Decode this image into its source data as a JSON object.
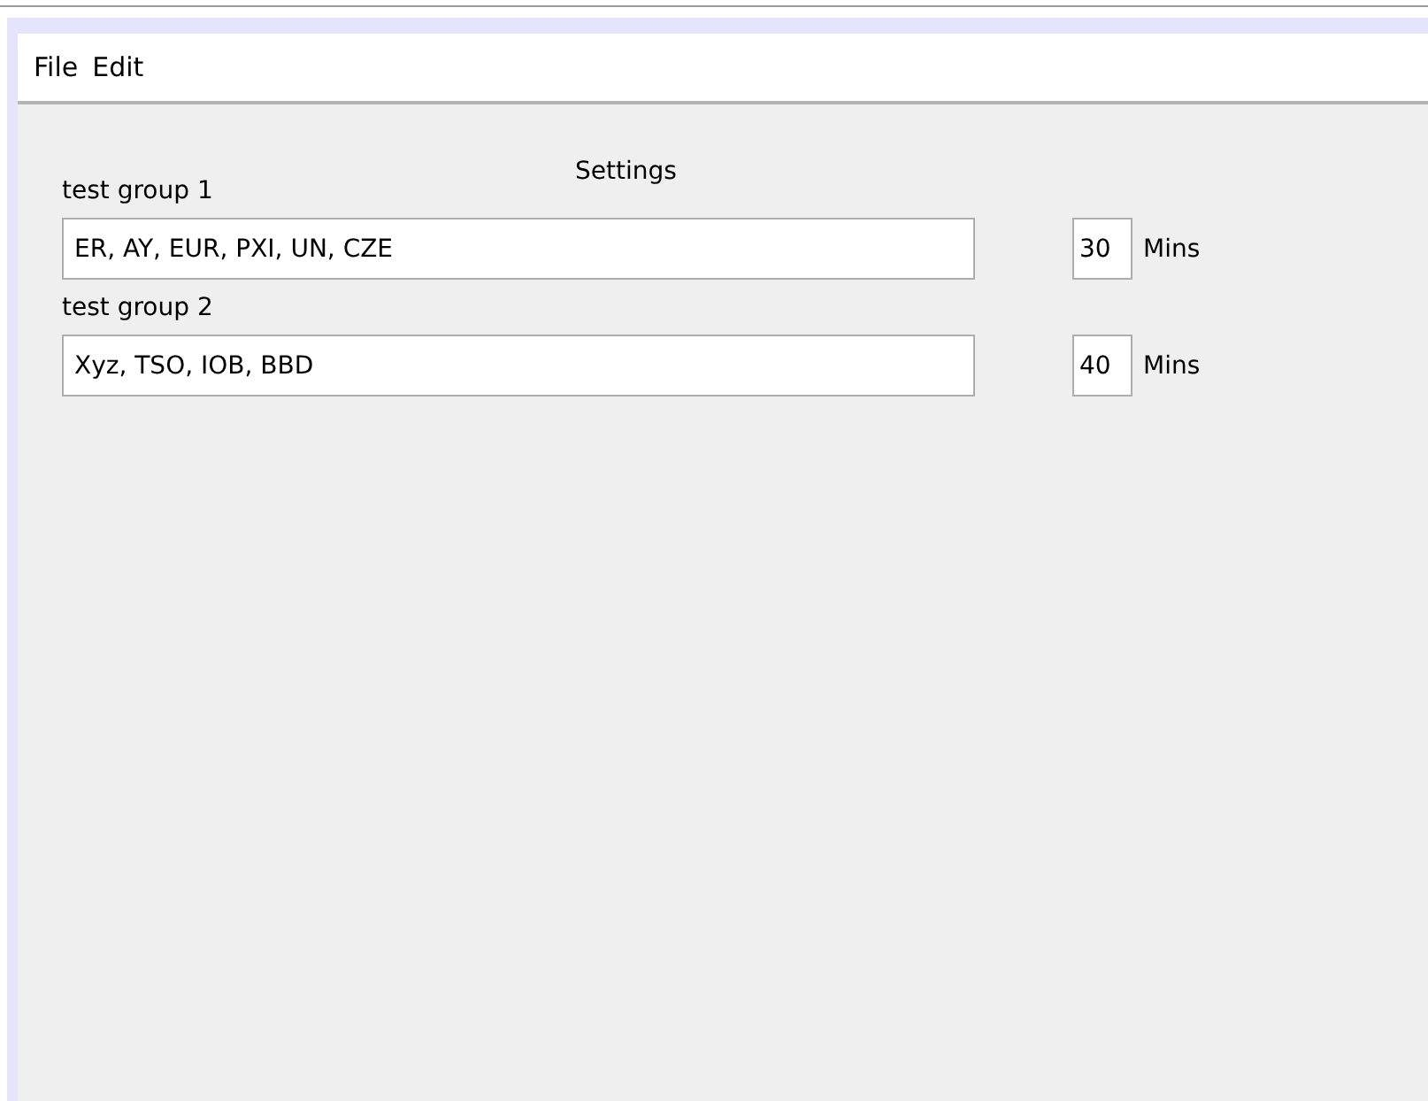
{
  "menu_bar": {
    "items": [
      {
        "label": "File"
      },
      {
        "label": "Edit"
      }
    ]
  },
  "panel": {
    "title": "Settings",
    "groups": [
      {
        "label": "test group 1",
        "value": "ER, AY, EUR, PXI, UN, CZE",
        "minutes": "30",
        "unit": "Mins"
      },
      {
        "label": "test group 2",
        "value": "Xyz, TSO, IOB, BBD",
        "minutes": "40",
        "unit": "Mins"
      }
    ]
  }
}
